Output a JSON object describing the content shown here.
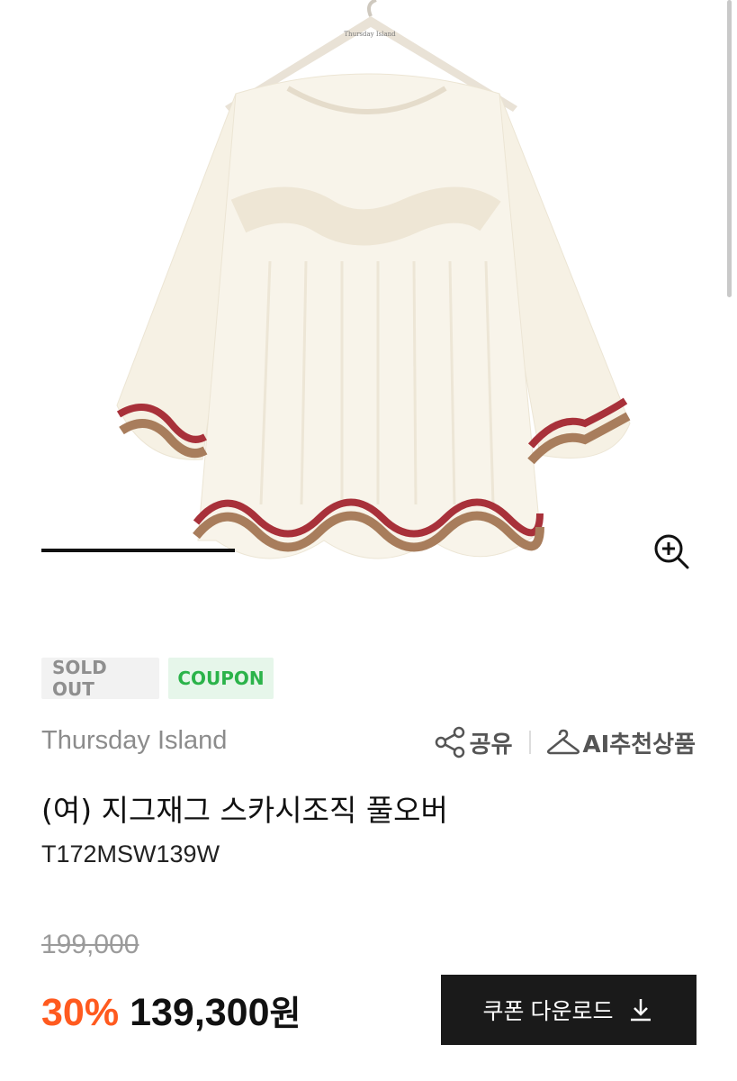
{
  "product": {
    "badges": {
      "sold_out": "SOLD OUT",
      "coupon": "COUPON"
    },
    "brand": "Thursday Island",
    "actions": {
      "share_label": "공유",
      "recommend_label": "AI추천상품"
    },
    "title": "(여) 지그재그 스카시조직 풀오버",
    "code": "T172MSW139W",
    "original_price": "199,000",
    "discount": "30%",
    "sale_price": "139,300",
    "currency": "원",
    "coupon_button_label": "쿠폰 다운로드",
    "hanger_brand": "Thursday Island"
  },
  "gallery": {
    "progress": 0.24,
    "icons": {
      "zoom": "zoom-in-icon",
      "share": "share-icon",
      "recommend": "hanger-icon",
      "download": "download-icon"
    }
  },
  "colors": {
    "discount": "#ff5a1f",
    "coupon_badge_text": "#2bb34a",
    "coupon_badge_bg": "#e6f6ea",
    "sold_out_bg": "#f2f2f2",
    "button_bg": "#1a1a1a",
    "sweater": "#f6f1e4",
    "stripe_red": "#a8313a",
    "stripe_brown": "#a87d5c"
  }
}
